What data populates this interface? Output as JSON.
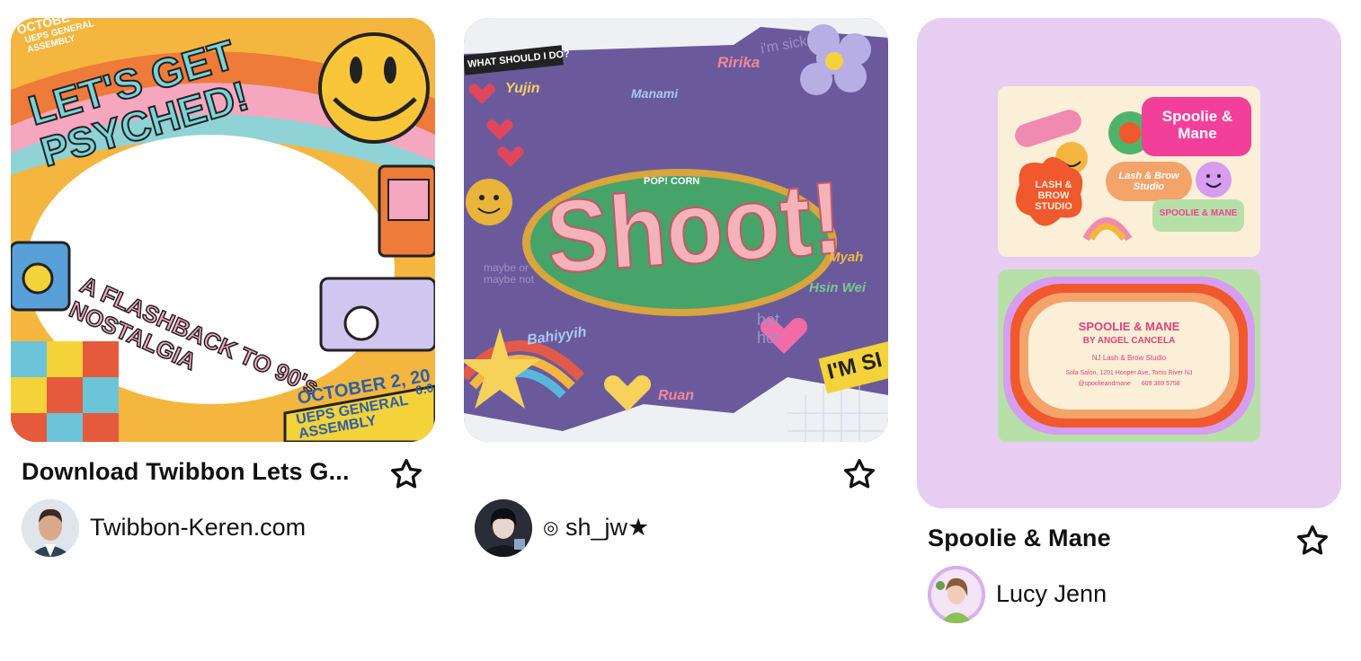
{
  "pins": [
    {
      "title": "Download Twibbon Lets G...",
      "author": "Twibbon-Keren.com",
      "image": {
        "headline": "LET'S GET PSYCHED!",
        "tagline": "A FLASHBACK TO 90's NOSTALGIA",
        "date_line": "OCTOBER 2, 20",
        "time": "6:0",
        "event": "UEPS GENERAL ASSEMBLY",
        "top_corner": "OCTOBE",
        "top_event": "UEPS GENERAL ASSEMBLY"
      }
    },
    {
      "title": "",
      "author_prefix": "◎",
      "author": "sh_jw★",
      "image": {
        "banner": "WHAT SHOULD I DO?",
        "small_label": "POP! CORN",
        "main_word": "Shoot!",
        "names": [
          "Yujin",
          "Manami",
          "Ririka",
          "Myah",
          "Hsin Wei",
          "Bahiyyih",
          "Ruan"
        ],
        "sticker": "I'M SI",
        "scribble_top": "i'm sick",
        "scribble_left": "maybe or maybe not",
        "scribble_right": "hot hot"
      }
    },
    {
      "title": "Spoolie & Mane",
      "author": "Lucy Jenn",
      "image": {
        "front_brand": "Spoolie & Mane",
        "front_studio": "LASH & BROW STUDIO",
        "front_script": "Lash & Brow Studio",
        "front_tag": "SPOOLIE & MANE",
        "back_name": "SPOOLIE & MANE",
        "back_by": "BY ANGEL CANCELA",
        "back_studio": "NJ Lash & Brow Studio",
        "back_address": "Sola Salon, 1201 Hooper Ave, Toms River NJ",
        "back_instagram": "@spoolieandmane",
        "back_phone": "609 389 5758"
      }
    }
  ],
  "colors": {
    "text": "#111111",
    "card3_bg": "#e6cdf1",
    "card2_bg": "#6a5a9c",
    "card1_bg": "#f4b63e"
  }
}
